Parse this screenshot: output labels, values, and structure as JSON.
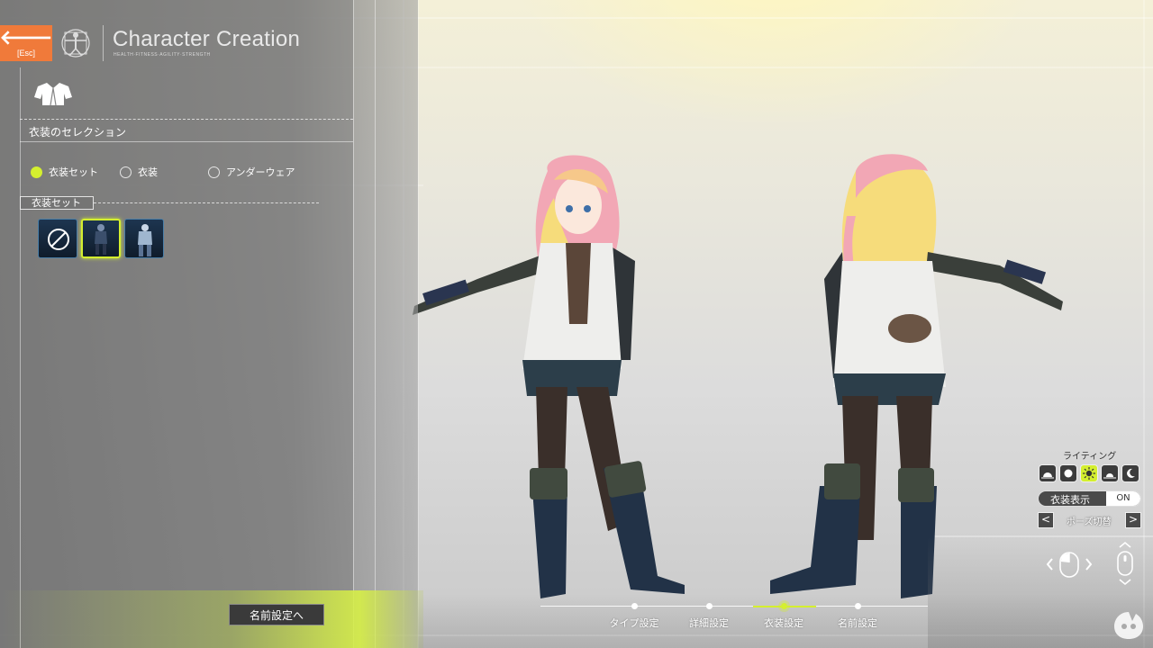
{
  "header": {
    "back_arrow": "🡐",
    "back_key": "[Esc]",
    "title": "Character Creation",
    "subtitle": "HEALTH·FITNESS·AGILITY·STRENGTH"
  },
  "section": {
    "title": "衣装のセレクション"
  },
  "costume_mode": {
    "options": [
      {
        "label": "衣装セット",
        "selected": true
      },
      {
        "label": "衣装",
        "selected": false
      },
      {
        "label": "アンダーウェア",
        "selected": false
      }
    ]
  },
  "costume_set": {
    "label": "衣装セット",
    "items": [
      "none",
      "outfit-dark",
      "outfit-light"
    ],
    "selected_index": 1
  },
  "name_button": "名前設定へ",
  "steps": [
    {
      "label": "タイプ設定",
      "active": false
    },
    {
      "label": "詳細設定",
      "active": false
    },
    {
      "label": "衣装設定",
      "active": true
    },
    {
      "label": "名前設定",
      "active": false
    }
  ],
  "lighting": {
    "label": "ライティング",
    "modes": [
      "sunrise-icon",
      "day-icon",
      "sun-icon",
      "sunset-icon",
      "moon-icon"
    ],
    "selected_index": 2
  },
  "costume_display": {
    "label": "衣装表示",
    "value": "ON"
  },
  "pose": {
    "label": "ポーズ切替",
    "prev": "<",
    "next": ">"
  },
  "colors": {
    "accent": "#d4ef2f",
    "back_button": "#f07a3a"
  }
}
